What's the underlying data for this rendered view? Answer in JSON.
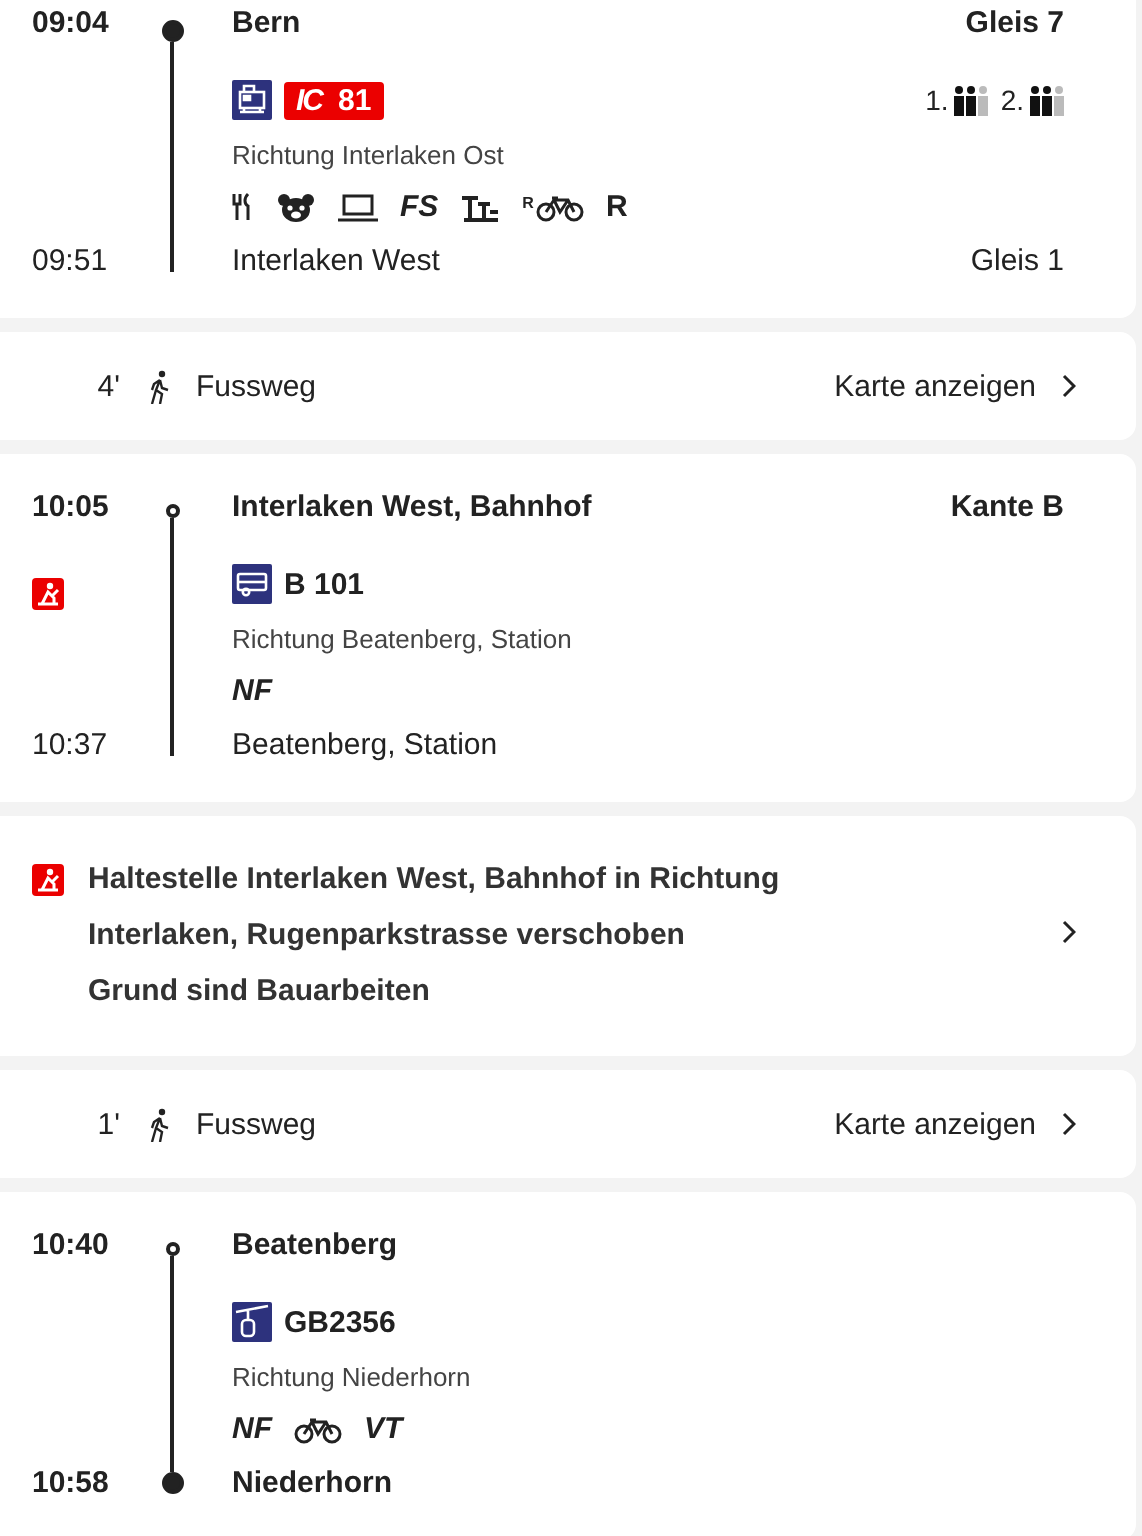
{
  "sections": [
    {
      "kind": "leg",
      "departure": {
        "time": "09:04",
        "stop": "Bern",
        "platform": "Gleis 7",
        "bold": true,
        "origin": true
      },
      "alert": false,
      "vehicle": {
        "kind": "train"
      },
      "line": {
        "kind": "badge",
        "product": "IC",
        "number": "81"
      },
      "occupancy": [
        {
          "class": "1."
        },
        {
          "class": "2."
        }
      ],
      "direction": "Richtung Interlaken Ost",
      "attributes": [
        {
          "kind": "cutlery"
        },
        {
          "kind": "bear"
        },
        {
          "kind": "laptop"
        },
        {
          "kind": "code",
          "text": "FS"
        },
        {
          "kind": "low-floor"
        },
        {
          "kind": "bike",
          "mark": "R"
        },
        {
          "kind": "letter",
          "text": "R"
        }
      ],
      "arrival": {
        "time": "09:51",
        "stop": "Interlaken West",
        "platform": "Gleis 1",
        "bold": false,
        "terminus": false
      }
    },
    {
      "kind": "walk",
      "duration": "4'",
      "label": "Fussweg",
      "action": "Karte anzeigen"
    },
    {
      "kind": "leg",
      "departure": {
        "time": "10:05",
        "stop": "Interlaken West, Bahnhof",
        "platform": "Kante B",
        "bold": true,
        "origin": false
      },
      "alert": true,
      "vehicle": {
        "kind": "bus"
      },
      "line": {
        "kind": "plain",
        "text": "B 101"
      },
      "direction": "Richtung Beatenberg, Station",
      "attributes": [
        {
          "kind": "code",
          "text": "NF"
        }
      ],
      "arrival": {
        "time": "10:37",
        "stop": "Beatenberg, Station",
        "bold": false,
        "terminus": false
      }
    },
    {
      "kind": "notice",
      "paragraphs": [
        "Haltestelle Interlaken West, Bahnhof in Richtung Interlaken, Rugenparkstrasse verschoben",
        "Grund sind Bauarbeiten"
      ]
    },
    {
      "kind": "walk",
      "duration": "1'",
      "label": "Fussweg",
      "action": "Karte anzeigen"
    },
    {
      "kind": "leg",
      "departure": {
        "time": "10:40",
        "stop": "Beatenberg",
        "bold": true,
        "origin": false
      },
      "alert": false,
      "vehicle": {
        "kind": "gondola"
      },
      "line": {
        "kind": "plain",
        "text": "GB2356"
      },
      "direction": "Richtung Niederhorn",
      "attributes": [
        {
          "kind": "code",
          "text": "NF"
        },
        {
          "kind": "bike"
        },
        {
          "kind": "code",
          "text": "VT"
        }
      ],
      "arrival": {
        "time": "10:58",
        "stop": "Niederhorn",
        "bold": true,
        "terminus": true
      }
    }
  ]
}
